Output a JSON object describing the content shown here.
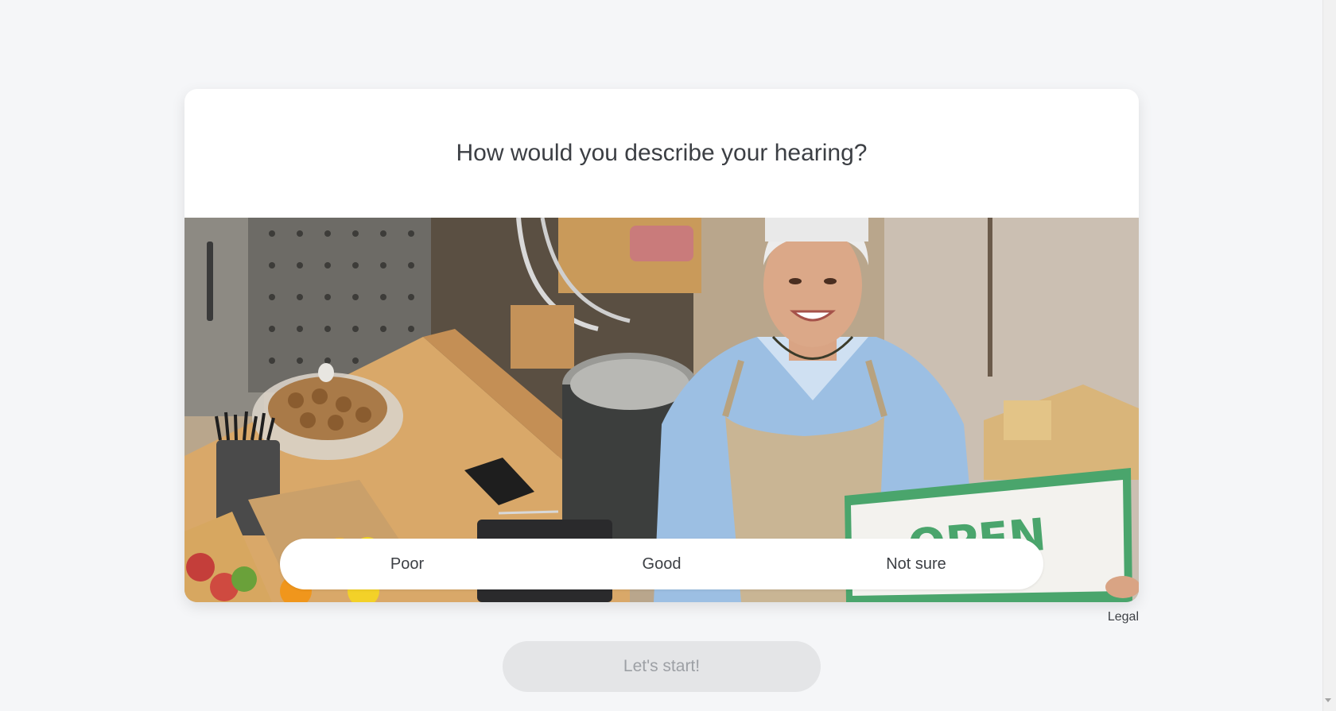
{
  "question": "How would you describe your hearing?",
  "options": [
    "Poor",
    "Good",
    "Not sure"
  ],
  "legal_link": "Legal",
  "start_button": "Let's start!",
  "photo": {
    "sign_text": "OPEN"
  },
  "colors": {
    "background": "#f5f6f8",
    "card": "#ffffff",
    "text": "#3c3f44",
    "button_disabled_bg": "#e4e5e7",
    "button_disabled_text": "#9da0a5",
    "sign_green": "#4aa56c"
  }
}
